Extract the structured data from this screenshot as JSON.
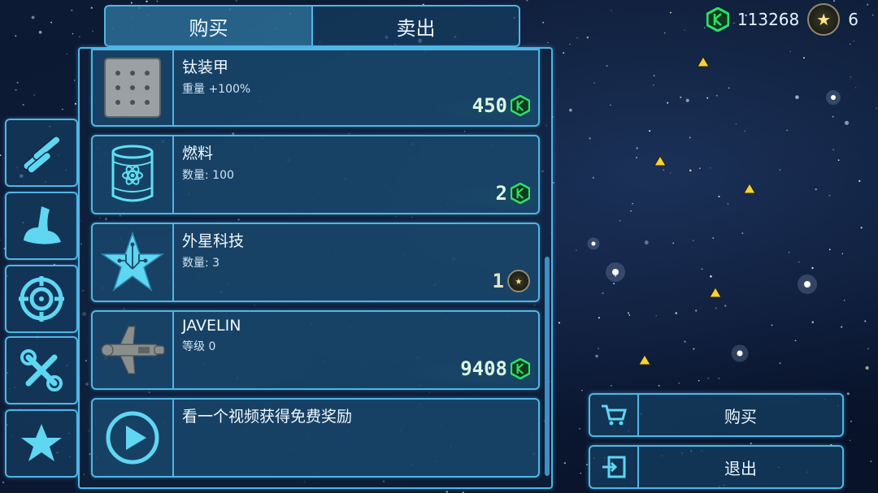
{
  "tabs": {
    "buy": "购买",
    "sell": "卖出"
  },
  "currency": {
    "credits": "113268",
    "stars": "6"
  },
  "colors": {
    "accent": "#4fb6e6",
    "credit_green": "#2ee06a",
    "star_gold": "#ffe68a"
  },
  "items": [
    {
      "name": "钛装甲",
      "sub": "重量 +100%",
      "price": "450",
      "currency": "credit",
      "icon": "armor-plate-icon"
    },
    {
      "name": "燃料",
      "sub": "数量: 100",
      "price": "2",
      "currency": "credit",
      "icon": "fuel-barrel-icon"
    },
    {
      "name": "外星科技",
      "sub": "数量: 3",
      "price": "1",
      "currency": "star",
      "icon": "alien-tech-star-icon"
    },
    {
      "name": "JAVELIN",
      "sub": "等级 0",
      "price": "9408",
      "currency": "credit",
      "icon": "spaceship-icon"
    },
    {
      "name": "看一个视频获得免费奖励",
      "sub": "",
      "price": "",
      "currency": "",
      "icon": "play-video-icon"
    }
  ],
  "categories": [
    "ammo-icon",
    "scoop-icon",
    "target-icon",
    "tools-icon",
    "favorites-star-icon"
  ],
  "actions": {
    "buy": "购买",
    "exit": "退出"
  }
}
